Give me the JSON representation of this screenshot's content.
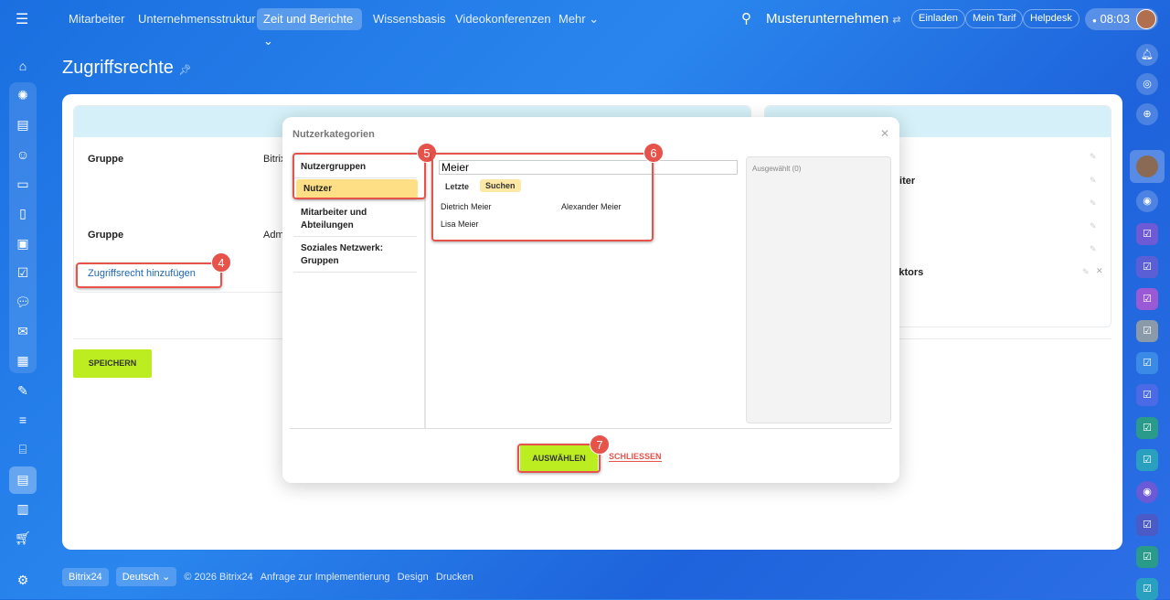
{
  "topnav": {
    "items": [
      "Mitarbeiter",
      "Unternehmensstruktur",
      "Zeit und Berichte",
      "Wissensbasis",
      "Videokonferenzen",
      "Mehr"
    ],
    "company": "Musterunternehmen",
    "buttons": [
      "Einladen",
      "Mein Tarif",
      "Helpdesk"
    ],
    "clock": "08:03"
  },
  "page": {
    "title": "Zugriffsrechte"
  },
  "left_panel": {
    "rows": [
      {
        "label": "Gruppe",
        "value": "Bitrix"
      },
      {
        "label": "Gruppe",
        "value": "Adm"
      }
    ],
    "add_link": "Zugriffsrecht hinzufügen"
  },
  "right_panel": {
    "rows": [
      "gsleiter",
      "Direktors"
    ]
  },
  "save_label": "SPEICHERN",
  "dialog": {
    "title": "Nutzerkategorien",
    "categories": [
      "Nutzergruppen",
      "Nutzer",
      "Mitarbeiter und Abteilungen",
      "Soziales Netzwerk: Gruppen"
    ],
    "search_value": "Meier",
    "tabs": [
      "Letzte",
      "Suchen"
    ],
    "results": [
      "Dietrich Meier",
      "Alexander Meier",
      "Lisa Meier"
    ],
    "selected_label": "Ausgewählt (0)",
    "select_button": "AUSWÄHLEN",
    "close_button": "SCHLIESSEN"
  },
  "annotations": [
    "4",
    "5",
    "6",
    "7"
  ],
  "footer": {
    "brand": "Bitrix24",
    "language": "Deutsch",
    "copyright": "© 2026 Bitrix24",
    "links": [
      "Anfrage zur Implementierung",
      "Design",
      "Drucken"
    ]
  }
}
